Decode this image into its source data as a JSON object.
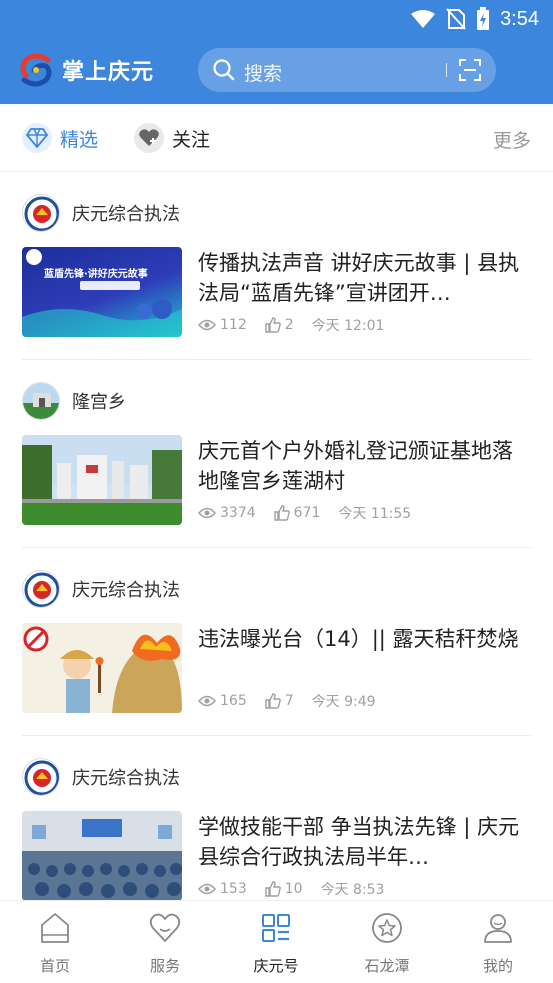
{
  "status_bar": {
    "time": "3:54"
  },
  "header": {
    "app_title": "掌上庆元",
    "search_placeholder": "搜索"
  },
  "tabs": {
    "items": [
      {
        "label": "精选",
        "icon": "diamond-icon",
        "active": true
      },
      {
        "label": "关注",
        "icon": "heart-plus-icon",
        "active": false
      }
    ],
    "more_label": "更多"
  },
  "feed": [
    {
      "source": "庆元综合执法",
      "title": "传播执法声音 讲好庆元故事 | 县执法局“蓝盾先锋”宣讲团开…",
      "views": "112",
      "likes": "2",
      "time": "今天 12:01",
      "thumb_text": "蓝盾先锋·讲好庆元故事"
    },
    {
      "source": "隆宫乡",
      "title": "庆元首个户外婚礼登记颁证基地落地隆宫乡莲湖村",
      "views": "3374",
      "likes": "671",
      "time": "今天 11:55"
    },
    {
      "source": "庆元综合执法",
      "title": "违法曝光台（14）|| 露天秸秆焚烧",
      "views": "165",
      "likes": "7",
      "time": "今天 9:49"
    },
    {
      "source": "庆元综合执法",
      "title": "学做技能干部 争当执法先锋 | 庆元县综合行政执法局半年…",
      "views": "153",
      "likes": "10",
      "time": "今天 8:53"
    }
  ],
  "bottom_nav": [
    {
      "label": "首页",
      "icon": "home-icon"
    },
    {
      "label": "服务",
      "icon": "heart-icon"
    },
    {
      "label": "庆元号",
      "icon": "grid-icon",
      "active": true
    },
    {
      "label": "石龙潭",
      "icon": "star-icon"
    },
    {
      "label": "我的",
      "icon": "user-icon"
    }
  ],
  "colors": {
    "brand": "#3d86de",
    "nav_active": "#3d86de",
    "meta_gray": "#a0a0a0"
  }
}
